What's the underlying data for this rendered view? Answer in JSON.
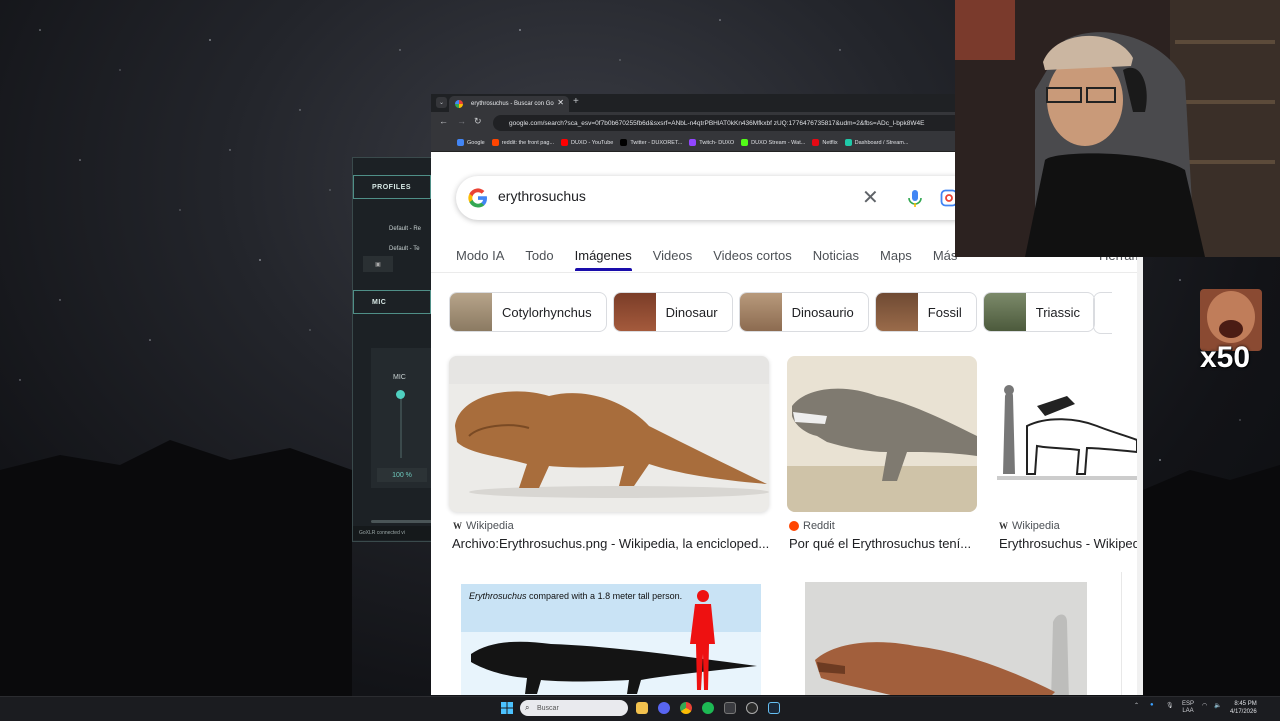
{
  "goxlr": {
    "profiles_tab": "PROFILES",
    "profile_1": "Default - Re",
    "profile_2": "Default - Te",
    "mic_tab": "MIC",
    "mic_label": "MIC",
    "mic_gain": "100 %",
    "status": "GoXLR connected vi"
  },
  "browser": {
    "tab_title": "erythrosuchus - Buscar con Go",
    "tab_close": "✕",
    "new_tab": "+",
    "url": "google.com/search?sca_esv=0f7b0b670255fb6d&sxsrf=ANbL-n4qtrPBHlAT0kKn436Mfkxbf zUQ:1776476735817&udm=2&fbs=ADc_l-bpk8W4E",
    "bookmarks": [
      {
        "label": "Google",
        "color": "#4285f4"
      },
      {
        "label": "reddit: the front pag...",
        "color": "#ff4500"
      },
      {
        "label": "DUXO - YouTube",
        "color": "#ff0000"
      },
      {
        "label": "Twitter - DUXORET...",
        "color": "#000000"
      },
      {
        "label": "Twitch- DUXO",
        "color": "#9146ff"
      },
      {
        "label": "DUXO Stream - Wat...",
        "color": "#53fc18"
      },
      {
        "label": "Netflix",
        "color": "#e50914"
      },
      {
        "label": "Dashboard / Stream...",
        "color": "#1fc9a9"
      }
    ]
  },
  "google": {
    "query": "erythrosuchus",
    "clear": "✕",
    "tabs": [
      "Modo IA",
      "Todo",
      "Imágenes",
      "Videos",
      "Videos cortos",
      "Noticias",
      "Maps",
      "Más"
    ],
    "tools": "Herram",
    "chips": [
      "Cotylorhynchus",
      "Dinosaur",
      "Dinosaurio",
      "Fossil",
      "Triassic"
    ],
    "results": [
      {
        "source": "Wikipedia",
        "title": "Archivo:Erythrosuchus.png - Wikipedia, la encicloped..."
      },
      {
        "source": "Reddit",
        "title": "Por qué el Erythrosuchus tení..."
      },
      {
        "source": "Wikipedia",
        "title": "Erythrosuchus - Wikiped"
      }
    ],
    "chart_caption_italic": "Erythrosuchus",
    "chart_caption_rest": " compared with a 1.8 meter tall person."
  },
  "overlay": {
    "badge_text": "x50"
  },
  "taskbar": {
    "search_placeholder": "Buscar",
    "lang_1": "ESP",
    "lang_2": "LAA",
    "time": "8:45 PM",
    "date": "4/17/2026"
  }
}
